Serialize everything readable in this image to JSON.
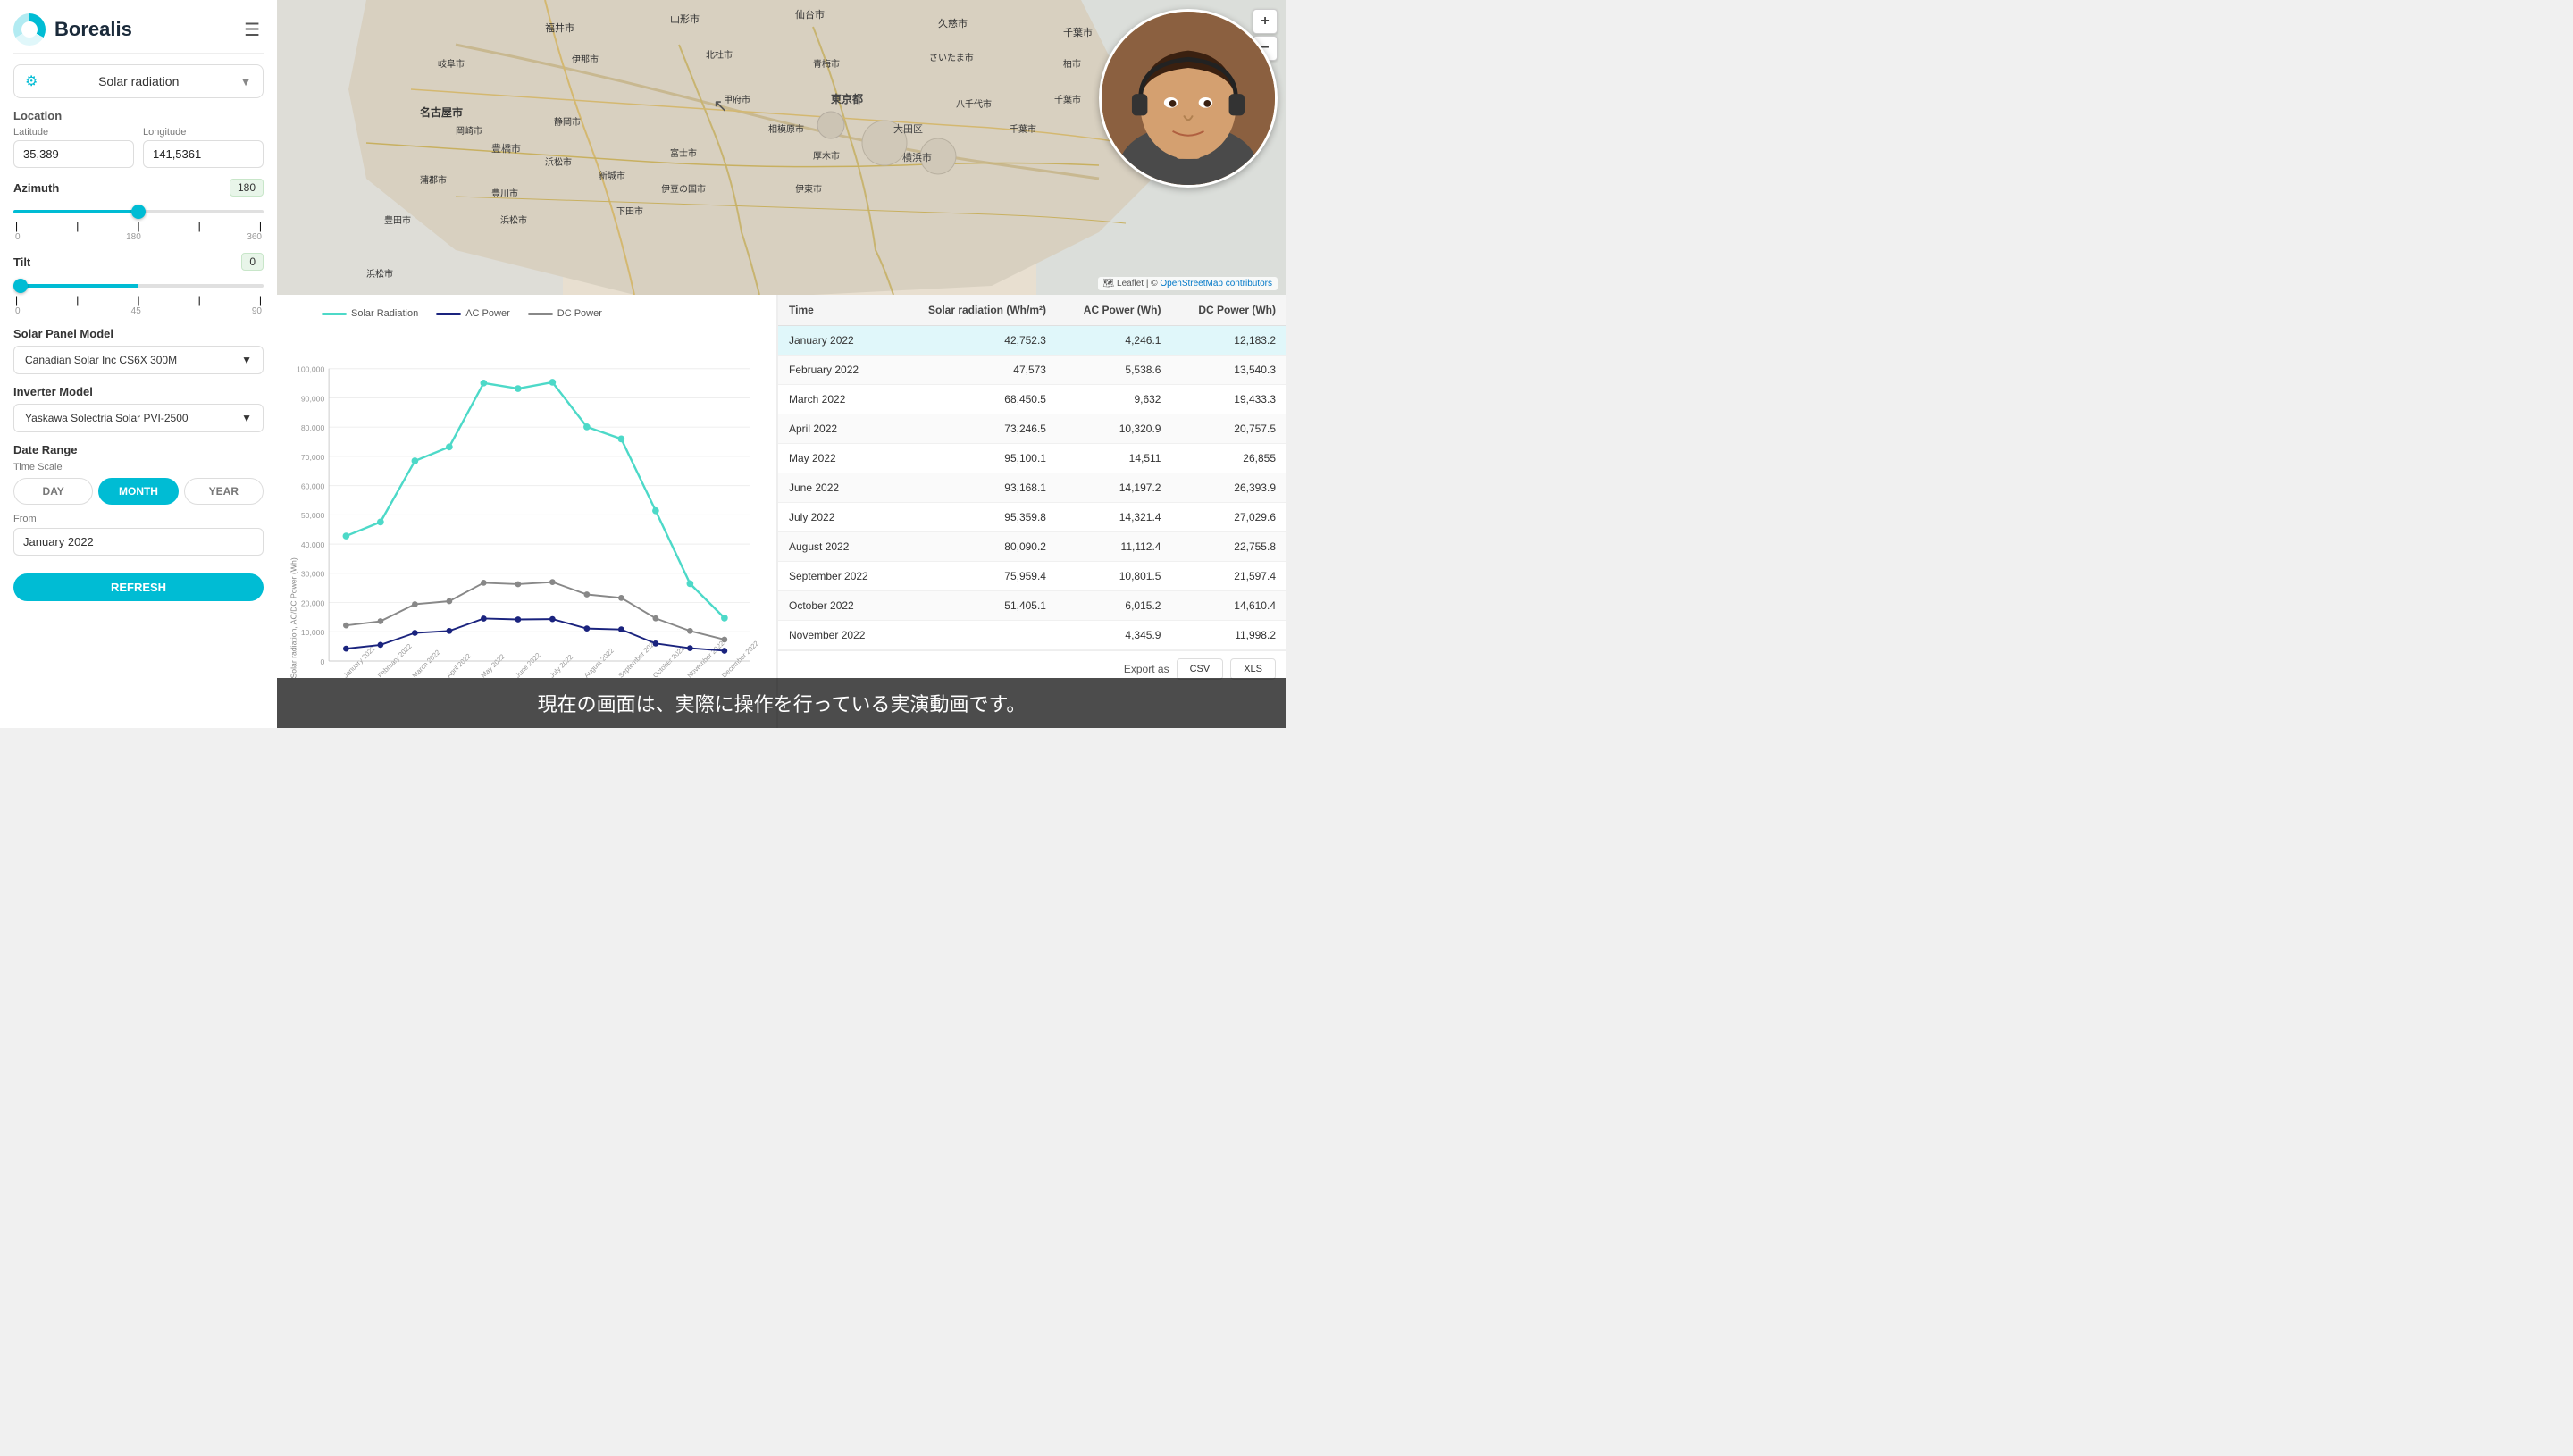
{
  "app": {
    "title": "Borealis",
    "logo_alt": "Borealis logo"
  },
  "sidebar": {
    "selector_label": "Solar radiation",
    "location": {
      "title": "Location",
      "latitude_label": "Latitude",
      "latitude_value": "35,389",
      "longitude_label": "Longitude",
      "longitude_value": "141,5361"
    },
    "azimuth": {
      "label": "Azimuth",
      "value": "180",
      "min": "0",
      "mid": "180",
      "max": "360",
      "slider_val": 50
    },
    "tilt": {
      "label": "Tilt",
      "value": "0",
      "tick0": "0",
      "tick45": "45",
      "tick90": "90",
      "slider_val": 0
    },
    "solar_panel": {
      "label": "Solar Panel Model",
      "value": "Canadian Solar Inc CS6X 300M"
    },
    "inverter": {
      "label": "Inverter Model",
      "value": "Yaskawa Solectria Solar PVI-2500"
    },
    "date_range": {
      "label": "Date Range",
      "time_scale_label": "Time Scale",
      "btn_day": "DAY",
      "btn_month": "MONTH",
      "btn_year": "YEAR",
      "active_scale": "MONTH",
      "from_label": "From",
      "from_value": "January 2022"
    },
    "refresh_label": "REFRESH"
  },
  "chart": {
    "legend": {
      "solar": "Solar Radiation",
      "ac": "AC Power",
      "dc": "DC Power"
    },
    "y_axis_label": "Solar radiation, AC/DC Power (Wh)",
    "y_ticks": [
      "0",
      "10,000",
      "20,000",
      "30,000",
      "40,000",
      "50,000",
      "60,000",
      "70,000",
      "80,000",
      "90,000",
      "100,000"
    ],
    "x_labels": [
      "January 2022",
      "February 2022",
      "March 2022",
      "April 2022",
      "May 2022",
      "June 2022",
      "July 2022",
      "August 2022",
      "September 2022",
      "October 2022",
      "November 2022",
      "December 2022"
    ],
    "solar_data": [
      42752.3,
      47573,
      68450.5,
      73246.5,
      95100.1,
      93168.1,
      95359.8,
      80090.2,
      75959.4,
      51405.1,
      null,
      null
    ],
    "ac_data": [
      4246.1,
      5538.6,
      9632,
      10320.9,
      14511,
      14197.2,
      14321.4,
      11112.4,
      10801.5,
      6015.2,
      null,
      null
    ],
    "dc_data": [
      12183.2,
      13540.3,
      19433.3,
      20757.5,
      26855,
      26393.9,
      27029.6,
      22755.8,
      21597.4,
      14610.4,
      null,
      null
    ]
  },
  "table": {
    "headers": [
      "Time",
      "Solar radiation (Wh/m²)",
      "AC Power (Wh)",
      "DC Power (Wh)"
    ],
    "rows": [
      {
        "time": "January 2022",
        "solar": "42,752.3",
        "ac": "4,246.1",
        "dc": "12,183.2",
        "highlight": true
      },
      {
        "time": "February 2022",
        "solar": "47,573",
        "ac": "5,538.6",
        "dc": "13,540.3",
        "highlight": false
      },
      {
        "time": "March 2022",
        "solar": "68,450.5",
        "ac": "9,632",
        "dc": "19,433.3",
        "highlight": false
      },
      {
        "time": "April 2022",
        "solar": "73,246.5",
        "ac": "10,320.9",
        "dc": "20,757.5",
        "highlight": false
      },
      {
        "time": "May 2022",
        "solar": "95,100.1",
        "ac": "14,511",
        "dc": "26,855",
        "highlight": false
      },
      {
        "time": "June 2022",
        "solar": "93,168.1",
        "ac": "14,197.2",
        "dc": "26,393.9",
        "highlight": false
      },
      {
        "time": "July 2022",
        "solar": "95,359.8",
        "ac": "14,321.4",
        "dc": "27,029.6",
        "highlight": false
      },
      {
        "time": "August 2022",
        "solar": "80,090.2",
        "ac": "11,112.4",
        "dc": "22,755.8",
        "highlight": false
      },
      {
        "time": "September 2022",
        "solar": "75,959.4",
        "ac": "10,801.5",
        "dc": "21,597.4",
        "highlight": false
      },
      {
        "time": "October 2022",
        "solar": "51,405.1",
        "ac": "6,015.2",
        "dc": "14,610.4",
        "highlight": false
      },
      {
        "time": "November 2022",
        "solar": "",
        "ac": "4,345.9",
        "dc": "11,998.2",
        "highlight": false
      }
    ],
    "export_label": "Export as",
    "export_csv": "CSV",
    "export_xls": "XLS"
  },
  "map": {
    "attribution_leaflet": "Leaflet",
    "attribution_osm": "OpenStreetMap contributors",
    "zoom_in": "+",
    "zoom_out": "−"
  },
  "subtitle": {
    "text": "現在の画面は、実際に操作を行っている実演動画です。"
  }
}
